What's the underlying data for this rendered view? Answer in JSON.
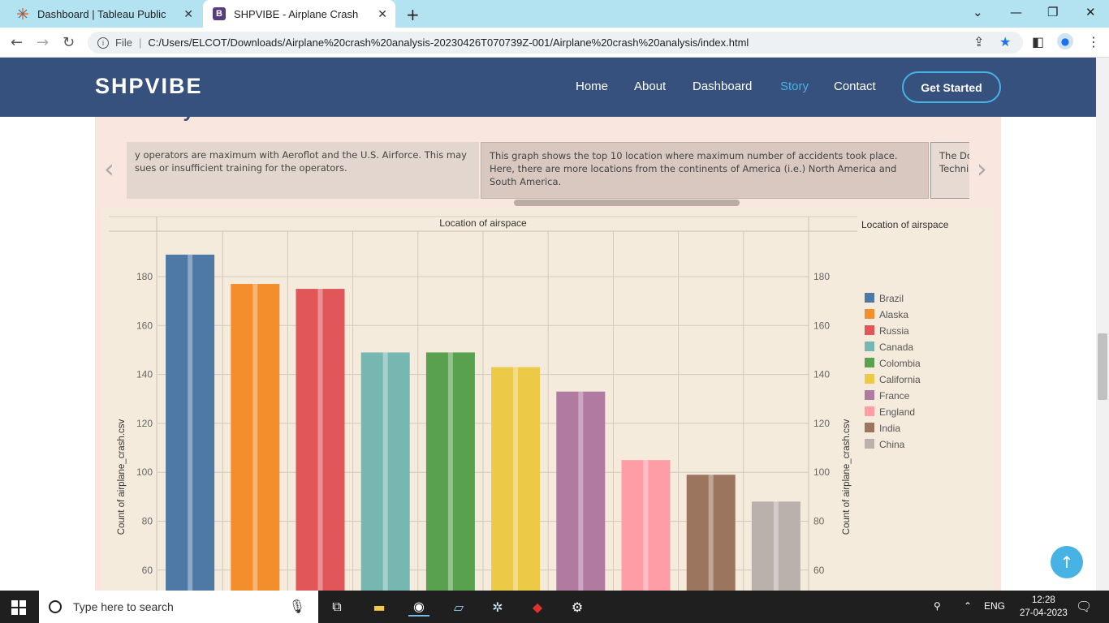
{
  "browser": {
    "tabs": [
      {
        "title": "Dashboard | Tableau Public",
        "icon": "tableau-icon"
      },
      {
        "title": "SHPVIBE - Airplane Crash",
        "icon": "bootstrap-icon",
        "icon_letter": "B"
      }
    ],
    "address": {
      "scheme_label": "File",
      "url": "C:/Users/ELCOT/Downloads/Airplane%20crash%20analysis-20230426T070739Z-001/Airplane%20crash%20analysis/index.html"
    }
  },
  "site": {
    "logo": "SHPVIBE",
    "nav": [
      {
        "label": "Home",
        "active": false
      },
      {
        "label": "About",
        "active": false
      },
      {
        "label": "Dashboard",
        "active": false
      },
      {
        "label": "Story",
        "active": true
      },
      {
        "label": "Contact",
        "active": false
      }
    ],
    "cta": "Get Started",
    "section_title": "The Analysis",
    "carousel": [
      {
        "text": "y operators are maximum with Aeroflot and the U.S. Airforce. This may sues or insufficient training for the operators."
      },
      {
        "text": "This graph shows the top 10 location where maximum number of accidents took place. Here, there are more locations from the continents of America (i.e.) North America and South America."
      },
      {
        "text": "The Do Techni"
      }
    ]
  },
  "chart_data": {
    "type": "bar",
    "title": "Location of airspace",
    "ylabel": "Count of airplane_crash.csv",
    "legend_title": "Location of airspace",
    "legend_position": "right",
    "categories": [
      "Brazil",
      "Alaska",
      "Russia",
      "Canada",
      "Colombia",
      "California",
      "France",
      "England",
      "India",
      "China"
    ],
    "values": [
      189,
      177,
      175,
      149,
      149,
      143,
      133,
      105,
      99,
      88
    ],
    "colors": [
      "#4e79a7",
      "#f28e2b",
      "#e15759",
      "#76b7b2",
      "#59a14f",
      "#edc948",
      "#b07aa1",
      "#ff9da7",
      "#9c755f",
      "#bab0ac"
    ],
    "yticks": [
      "180",
      "160",
      "140",
      "120",
      "100",
      "80",
      "60"
    ],
    "ylim": [
      53,
      199
    ],
    "grid": true
  },
  "taskbar": {
    "search_placeholder": "Type here to search",
    "lang": "ENG",
    "time": "12:28",
    "date": "27-04-2023"
  }
}
